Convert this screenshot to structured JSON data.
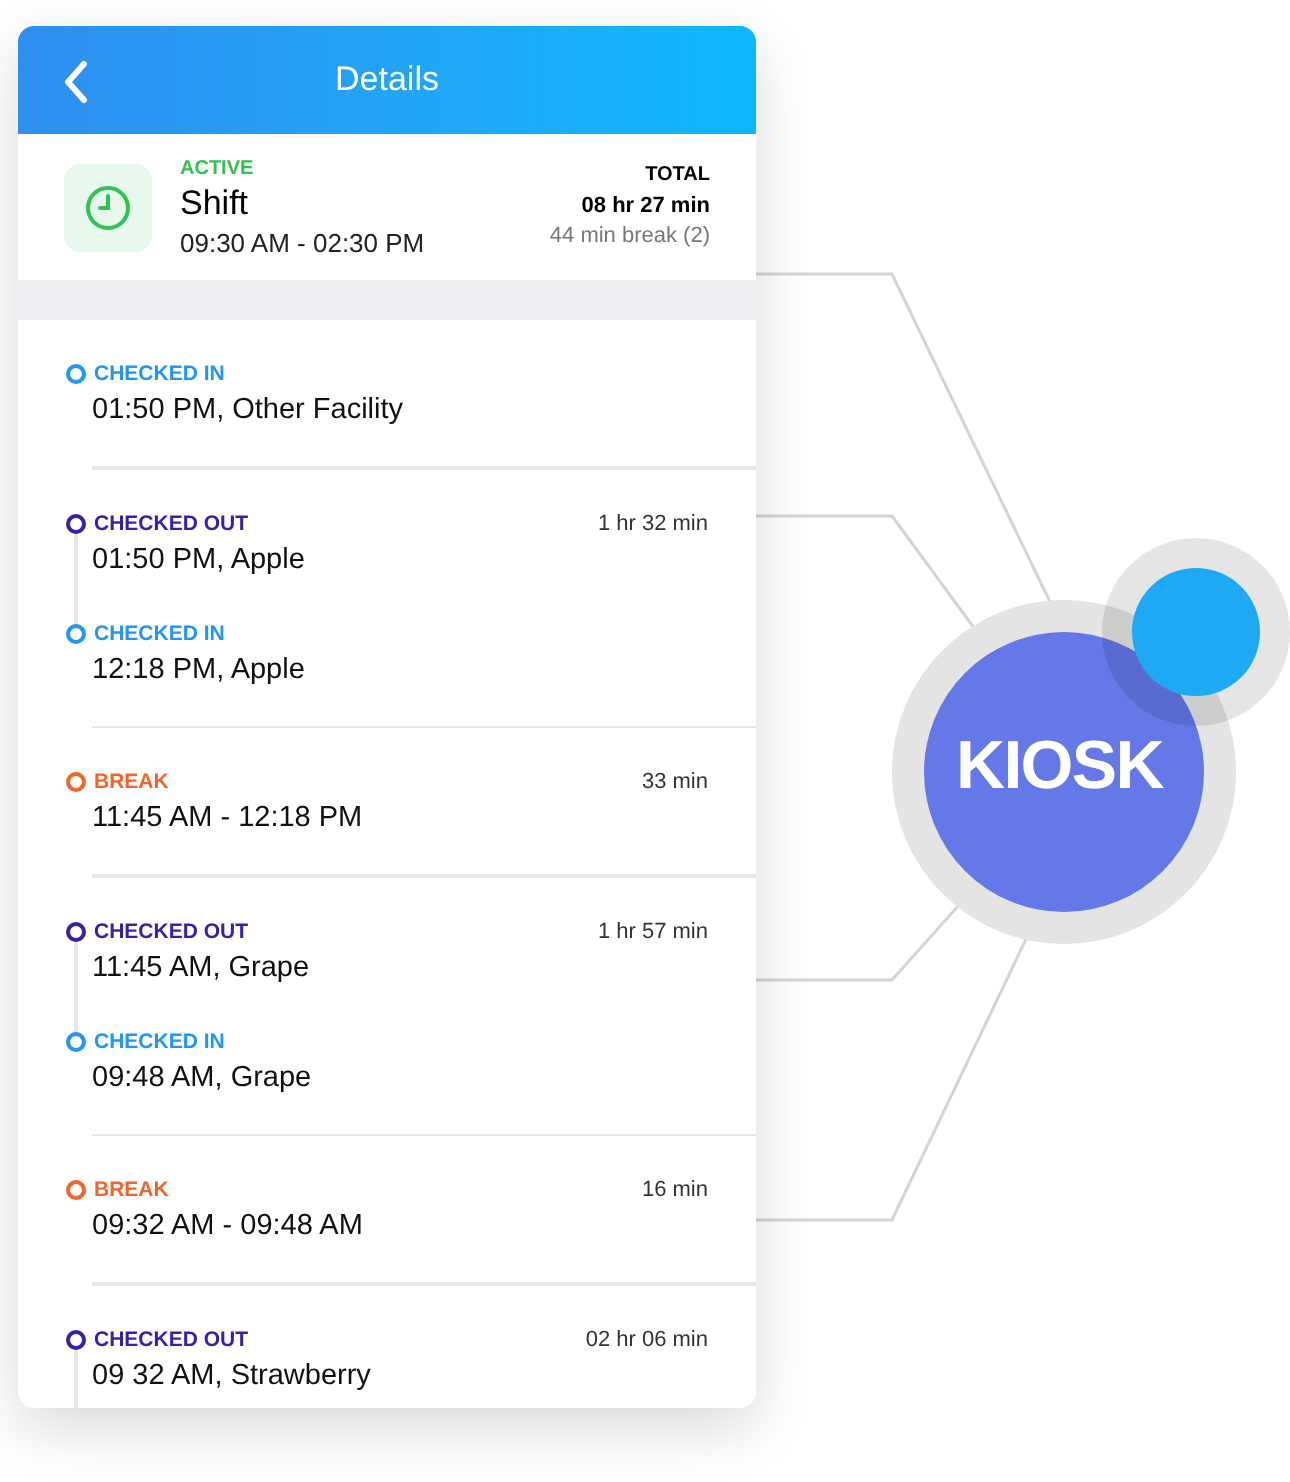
{
  "header": {
    "title": "Details"
  },
  "shift": {
    "status": "ACTIVE",
    "title": "Shift",
    "time": "09:30 AM - 02:30 PM",
    "total_label": "TOTAL",
    "total": "08 hr 27 min",
    "breaks": "44 min break (2)"
  },
  "groups": [
    {
      "events": [
        {
          "kind": "checked_in",
          "label": "CHECKED IN",
          "detail": "01:50 PM, Other Facility"
        }
      ]
    },
    {
      "duration": "1 hr 32 min",
      "events": [
        {
          "kind": "checked_out",
          "label": "CHECKED OUT",
          "detail": "01:50 PM, Apple"
        },
        {
          "kind": "checked_in",
          "label": "CHECKED IN",
          "detail": "12:18 PM, Apple"
        }
      ]
    },
    {
      "duration": "33 min",
      "events": [
        {
          "kind": "break",
          "label": "BREAK",
          "detail": "11:45 AM - 12:18 PM"
        }
      ]
    },
    {
      "duration": "1 hr 57 min",
      "events": [
        {
          "kind": "checked_out",
          "label": "CHECKED OUT",
          "detail": "11:45 AM, Grape"
        },
        {
          "kind": "checked_in",
          "label": "CHECKED IN",
          "detail": "09:48 AM, Grape"
        }
      ]
    },
    {
      "duration": "16 min",
      "events": [
        {
          "kind": "break",
          "label": "BREAK",
          "detail": "09:32 AM - 09:48 AM"
        }
      ]
    },
    {
      "duration": "02 hr 06 min",
      "events": [
        {
          "kind": "checked_out",
          "label": "CHECKED OUT",
          "detail": "09 32 AM, Strawberry"
        }
      ]
    }
  ],
  "logo": "KIOSK"
}
